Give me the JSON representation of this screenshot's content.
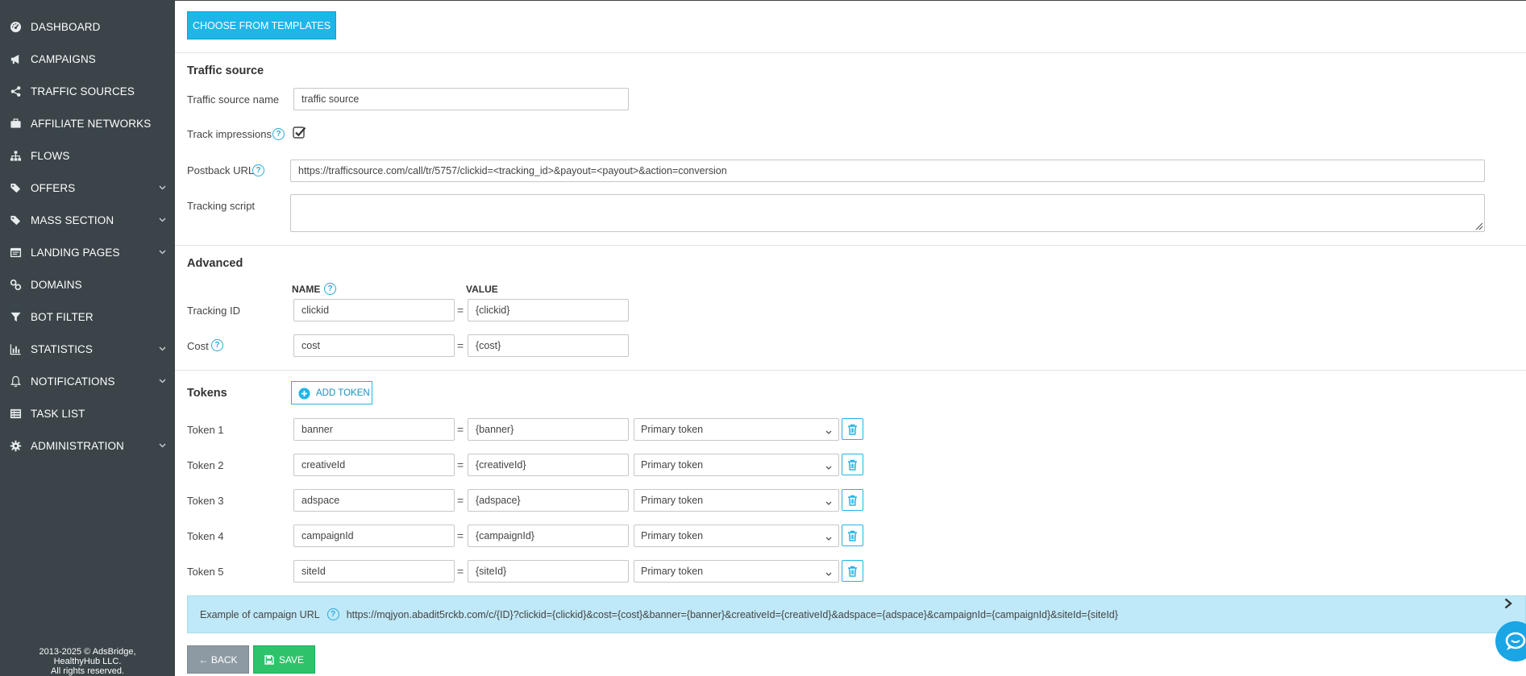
{
  "sidebar": {
    "items": [
      {
        "label": "DASHBOARD",
        "icon": "dashboard-icon",
        "has_submenu": false
      },
      {
        "label": "CAMPAIGNS",
        "icon": "megaphone-icon",
        "has_submenu": false
      },
      {
        "label": "TRAFFIC SOURCES",
        "icon": "share-icon",
        "has_submenu": false
      },
      {
        "label": "AFFILIATE NETWORKS",
        "icon": "briefcase-icon",
        "has_submenu": false
      },
      {
        "label": "FLOWS",
        "icon": "sitemap-icon",
        "has_submenu": false
      },
      {
        "label": "OFFERS",
        "icon": "tags-icon",
        "has_submenu": true
      },
      {
        "label": "MASS SECTION",
        "icon": "tags-icon",
        "has_submenu": true
      },
      {
        "label": "LANDING PAGES",
        "icon": "window-icon",
        "has_submenu": true
      },
      {
        "label": "DOMAINS",
        "icon": "link-icon",
        "has_submenu": false
      },
      {
        "label": "BOT FILTER",
        "icon": "filter-icon",
        "has_submenu": false
      },
      {
        "label": "STATISTICS",
        "icon": "bar-chart-icon",
        "has_submenu": true
      },
      {
        "label": "NOTIFICATIONS",
        "icon": "bell-icon",
        "has_submenu": true
      },
      {
        "label": "TASK LIST",
        "icon": "list-icon",
        "has_submenu": false
      },
      {
        "label": "ADMINISTRATION",
        "icon": "gear-icon",
        "has_submenu": true
      }
    ],
    "footer": {
      "line1": "2013-2025 © AdsBridge,",
      "line2": "HealthyHub LLC.",
      "line3": "All rights reserved."
    }
  },
  "toolbar": {
    "choose_templates": "CHOOSE FROM TEMPLATES"
  },
  "traffic_source": {
    "title": "Traffic source",
    "name_label": "Traffic source name",
    "name_value": "traffic source",
    "track_impressions_label": "Track impressions",
    "track_impressions_checked": true,
    "postback_label": "Postback URL",
    "postback_value": "https://trafficsource.com/call/tr/5757/clickid=<tracking_id>&payout=<payout>&action=conversion",
    "tracking_script_label": "Tracking script",
    "tracking_script_value": ""
  },
  "advanced": {
    "title": "Advanced",
    "col_name": "NAME",
    "col_value": "VALUE",
    "eq": "=",
    "tracking_id_label": "Tracking ID",
    "tracking_id_name": "clickid",
    "tracking_id_value": "{clickid}",
    "cost_label": "Cost",
    "cost_name": "cost",
    "cost_value": "{cost}"
  },
  "tokens": {
    "title": "Tokens",
    "add_label": "ADD TOKEN",
    "rows": [
      {
        "label": "Token 1",
        "name": "banner",
        "value": "{banner}",
        "type": "Primary token"
      },
      {
        "label": "Token 2",
        "name": "creativeId",
        "value": "{creativeId}",
        "type": "Primary token"
      },
      {
        "label": "Token 3",
        "name": "adspace",
        "value": "{adspace}",
        "type": "Primary token"
      },
      {
        "label": "Token 4",
        "name": "campaignId",
        "value": "{campaignId}",
        "type": "Primary token"
      },
      {
        "label": "Token 5",
        "name": "siteId",
        "value": "{siteId}",
        "type": "Primary token"
      }
    ]
  },
  "example": {
    "label": "Example of campaign URL",
    "url": "https://mqjyon.abadit5rckb.com/c/{ID}?clickid={clickid}&cost={cost}&banner={banner}&creativeId={creativeId}&adspace={adspace}&campaignId={campaignId}&siteId={siteId}"
  },
  "actions": {
    "back": "← BACK",
    "save": "SAVE"
  },
  "colors": {
    "sidebar": "#3a4449",
    "accent": "#1eb6e8",
    "save": "#2ec36b",
    "back": "#8e9aa3",
    "example_bg": "#bfe9f8"
  }
}
